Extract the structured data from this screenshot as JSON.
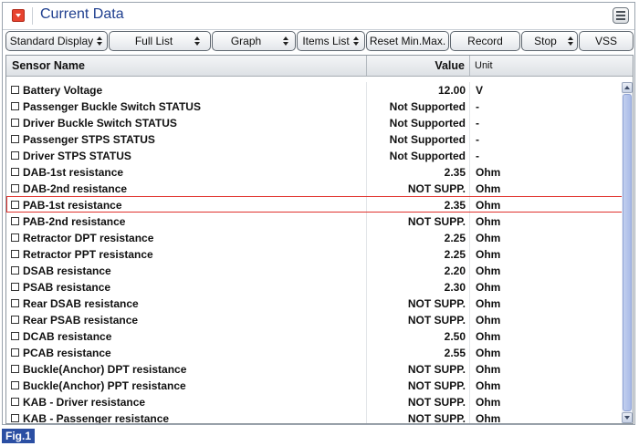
{
  "window": {
    "title": "Current Data"
  },
  "toolbar": {
    "standard_display": "Standard Display",
    "full_list": "Full List",
    "graph": "Graph",
    "items_list": "Items List",
    "reset": "Reset Min.Max.",
    "record": "Record",
    "stop": "Stop",
    "vss": "VSS"
  },
  "columns": {
    "name": "Sensor Name",
    "value": "Value",
    "unit": "Unit"
  },
  "rows": [
    {
      "name": "Battery Voltage",
      "value": "12.00",
      "unit": "V"
    },
    {
      "name": "Passenger Buckle Switch STATUS",
      "value": "Not Supported",
      "unit": "-"
    },
    {
      "name": "Driver Buckle Switch STATUS",
      "value": "Not Supported",
      "unit": "-"
    },
    {
      "name": "Passenger STPS STATUS",
      "value": "Not Supported",
      "unit": "-"
    },
    {
      "name": "Driver STPS STATUS",
      "value": "Not Supported",
      "unit": "-"
    },
    {
      "name": "DAB-1st resistance",
      "value": "2.35",
      "unit": "Ohm"
    },
    {
      "name": "DAB-2nd resistance",
      "value": "NOT SUPP.",
      "unit": "Ohm"
    },
    {
      "name": "PAB-1st resistance",
      "value": "2.35",
      "unit": "Ohm"
    },
    {
      "name": "PAB-2nd resistance",
      "value": "NOT SUPP.",
      "unit": "Ohm"
    },
    {
      "name": "Retractor DPT resistance",
      "value": "2.25",
      "unit": "Ohm"
    },
    {
      "name": "Retractor PPT resistance",
      "value": "2.25",
      "unit": "Ohm"
    },
    {
      "name": "DSAB resistance",
      "value": "2.20",
      "unit": "Ohm"
    },
    {
      "name": "PSAB resistance",
      "value": "2.30",
      "unit": "Ohm"
    },
    {
      "name": "Rear DSAB resistance",
      "value": "NOT SUPP.",
      "unit": "Ohm"
    },
    {
      "name": "Rear PSAB resistance",
      "value": "NOT SUPP.",
      "unit": "Ohm"
    },
    {
      "name": "DCAB resistance",
      "value": "2.50",
      "unit": "Ohm"
    },
    {
      "name": "PCAB resistance",
      "value": "2.55",
      "unit": "Ohm"
    },
    {
      "name": "Buckle(Anchor) DPT resistance",
      "value": "NOT SUPP.",
      "unit": "Ohm"
    },
    {
      "name": "Buckle(Anchor) PPT resistance",
      "value": "NOT SUPP.",
      "unit": "Ohm"
    },
    {
      "name": "KAB - Driver resistance",
      "value": "NOT SUPP.",
      "unit": "Ohm"
    },
    {
      "name": "KAB - Passenger resistance",
      "value": "NOT SUPP.",
      "unit": "Ohm"
    }
  ],
  "selected_row": 7,
  "figure_label": "Fig.1",
  "colors": {
    "title": "#1f3f8f",
    "selection": "#e0332e",
    "figure_label_bg": "#2b4fa3"
  },
  "icons": {
    "title_dropdown": "dropdown-arrow-icon",
    "menu": "menu-icon"
  }
}
